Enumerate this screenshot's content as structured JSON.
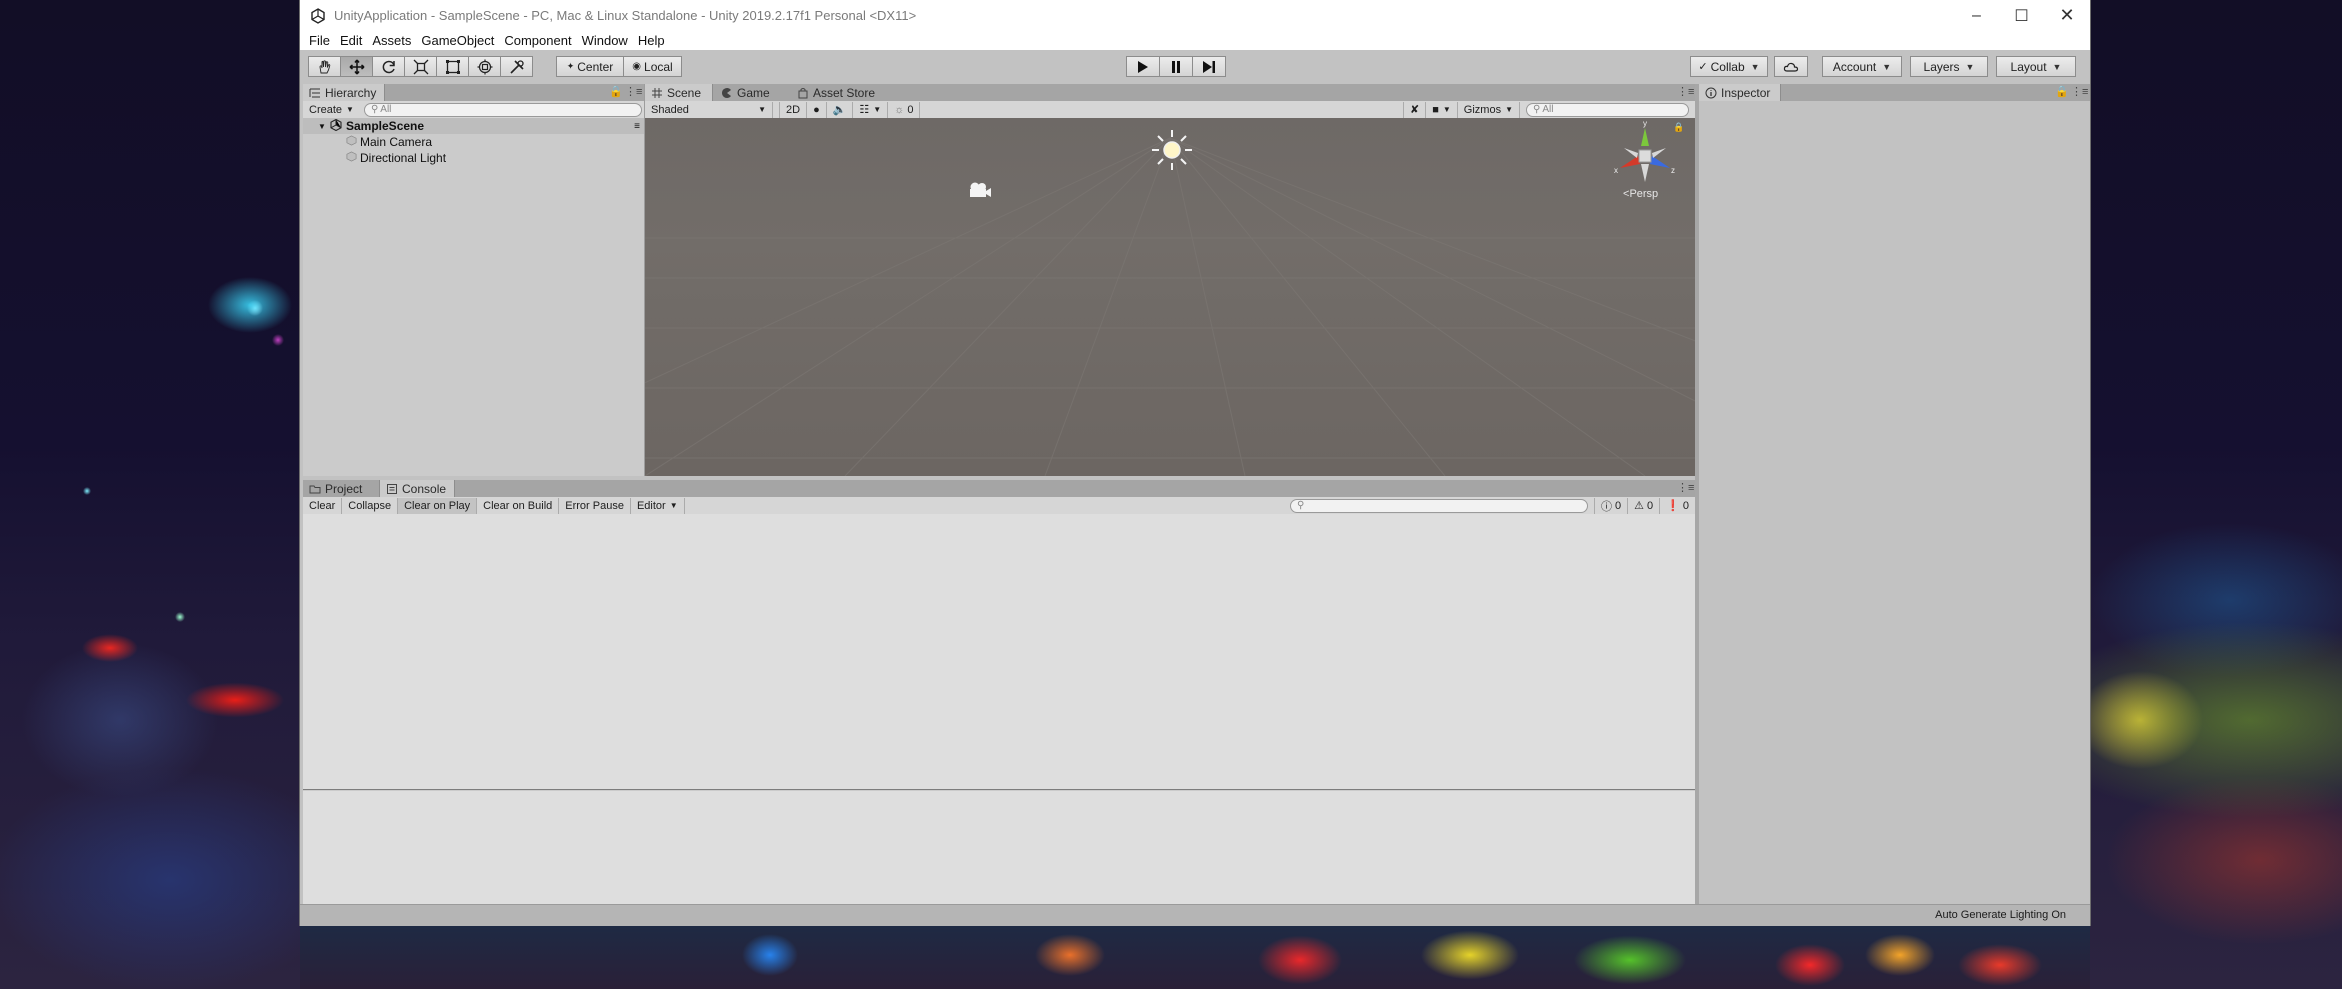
{
  "window": {
    "title": "UnityApplication - SampleScene - PC, Mac & Linux Standalone - Unity 2019.2.17f1 Personal <DX11>"
  },
  "menu": [
    "File",
    "Edit",
    "Assets",
    "GameObject",
    "Component",
    "Window",
    "Help"
  ],
  "toolbar": {
    "pivot_label": "Center",
    "space_label": "Local",
    "collab_label": "Collab",
    "account_label": "Account",
    "layers_label": "Layers",
    "layout_label": "Layout"
  },
  "hierarchy": {
    "tab_label": "Hierarchy",
    "create_label": "Create",
    "search_placeholder": "All",
    "scene_name": "SampleScene",
    "items": [
      "Main Camera",
      "Directional Light"
    ]
  },
  "scene_panel": {
    "tabs": [
      "Scene",
      "Game",
      "Asset Store"
    ],
    "shading_mode": "Shaded",
    "mode_2d": "2D",
    "hidden_count": "0",
    "gizmos_label": "Gizmos",
    "search_placeholder": "All",
    "projection_label": "Persp",
    "axes": {
      "y": "y",
      "x": "x",
      "z": "z"
    }
  },
  "console_panel": {
    "tabs": [
      "Project",
      "Console"
    ],
    "buttons": [
      "Clear",
      "Collapse",
      "Clear on Play",
      "Clear on Build",
      "Error Pause"
    ],
    "editor_label": "Editor",
    "log_count": "0",
    "warning_count": "0",
    "error_count": "0"
  },
  "inspector": {
    "tab_label": "Inspector"
  },
  "status": {
    "text": "Auto Generate Lighting On"
  },
  "colors": {
    "editor_bg": "#c2c2c2",
    "scene_bg": "#706b68",
    "axis_y": "#7cc83c",
    "axis_x": "#d43a2a",
    "axis_z": "#3a6ae0"
  }
}
